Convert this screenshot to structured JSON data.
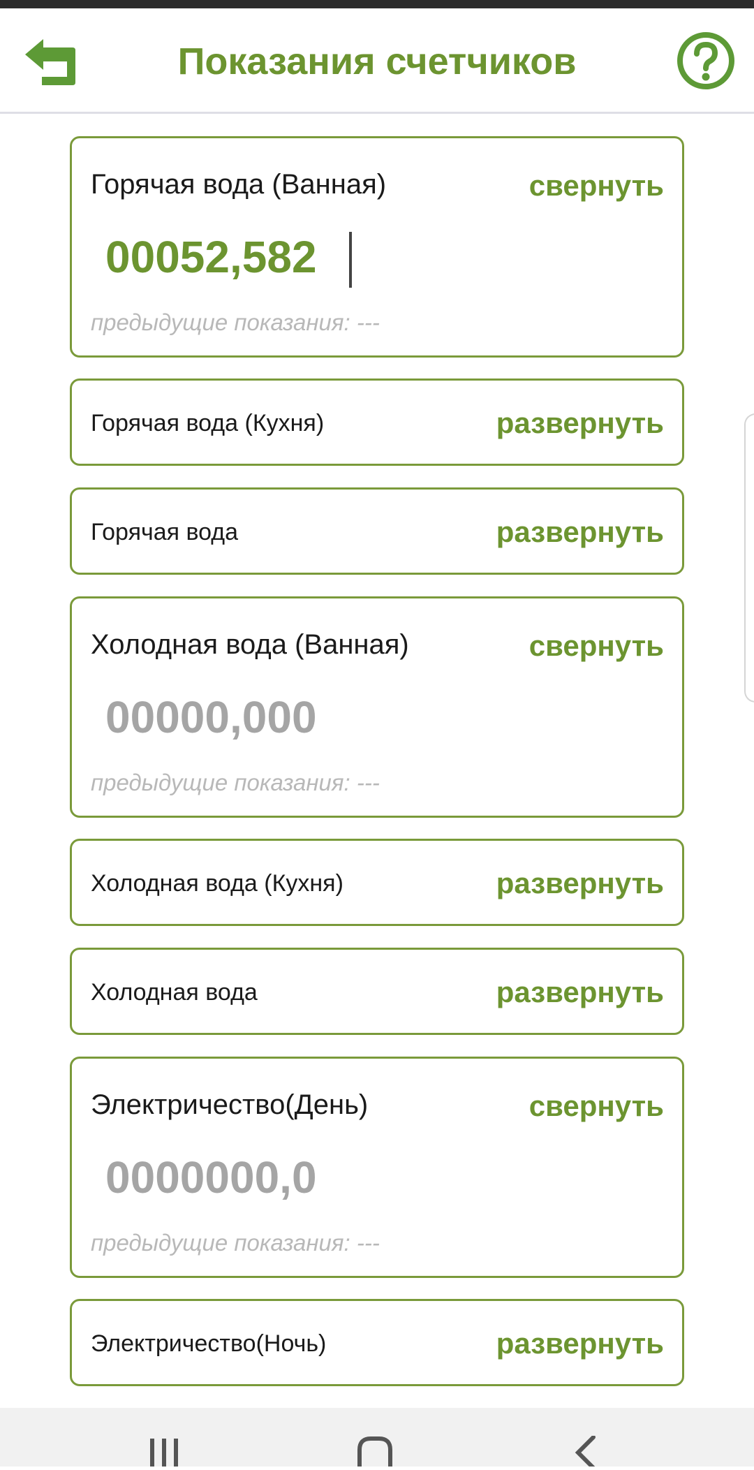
{
  "header": {
    "title": "Показания счетчиков",
    "back_icon": "back-arrow-icon",
    "help_icon": "help-circle-icon",
    "accent_color": "#6c9430"
  },
  "meters": [
    {
      "name": "Горячая вода (Ванная)",
      "state": "expanded",
      "toggle_label": "свернуть",
      "value": "00052,582",
      "value_entered": true,
      "previous_label": "предыдущие показания: ---"
    },
    {
      "name": "Горячая вода (Кухня)",
      "state": "collapsed",
      "toggle_label": "развернуть"
    },
    {
      "name": "Горячая вода",
      "state": "collapsed",
      "toggle_label": "развернуть"
    },
    {
      "name": "Холодная вода (Ванная)",
      "state": "expanded",
      "toggle_label": "свернуть",
      "value": "00000,000",
      "value_entered": false,
      "previous_label": "предыдущие показания: ---"
    },
    {
      "name": "Холодная вода (Кухня)",
      "state": "collapsed",
      "toggle_label": "развернуть"
    },
    {
      "name": "Холодная вода",
      "state": "collapsed",
      "toggle_label": "развернуть"
    },
    {
      "name": "Электричество(День)",
      "state": "expanded",
      "toggle_label": "свернуть",
      "value": "0000000,0",
      "value_entered": false,
      "previous_label": "предыдущие показания: ---"
    },
    {
      "name": "Электричество(Ночь)",
      "state": "collapsed",
      "toggle_label": "развернуть"
    }
  ],
  "navigation_bar": {
    "recents_icon": "recents-icon",
    "home_icon": "home-icon",
    "back_icon": "nav-back-icon"
  }
}
